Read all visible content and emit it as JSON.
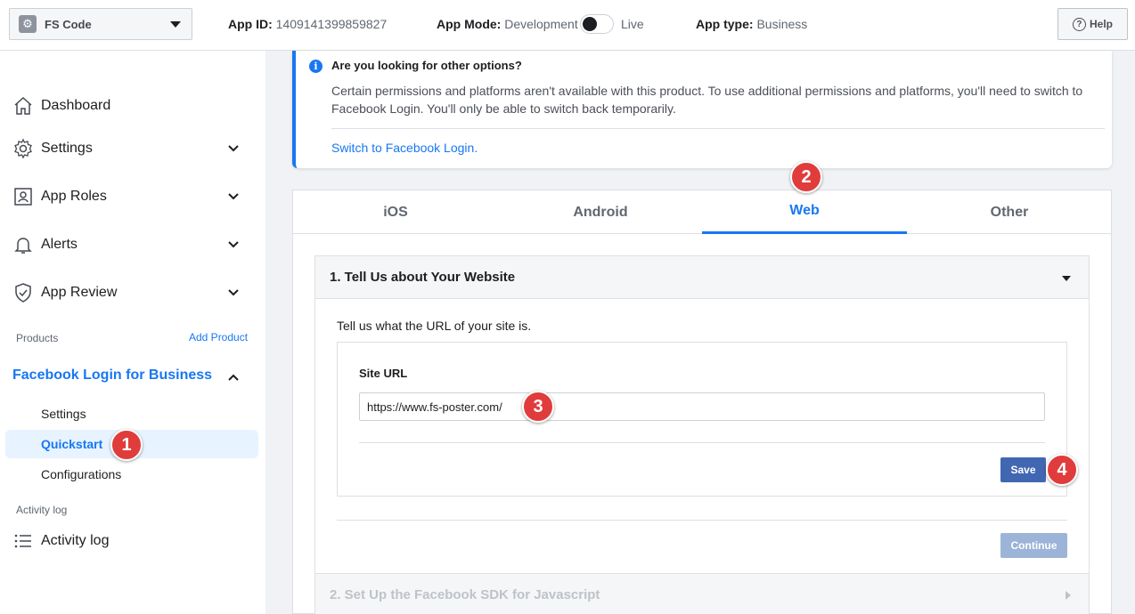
{
  "topbar": {
    "app_name": "FS Code",
    "app_id_label": "App ID:",
    "app_id_value": "1409141399859827",
    "app_mode_label": "App Mode:",
    "app_mode_value": "Development",
    "app_mode_toggle_label": "Live",
    "app_mode_live": false,
    "app_type_label": "App type:",
    "app_type_value": "Business",
    "help_label": "Help"
  },
  "sidebar": {
    "items": [
      {
        "label": "Dashboard",
        "icon": "home-icon"
      },
      {
        "label": "Settings",
        "icon": "gear-icon"
      },
      {
        "label": "App Roles",
        "icon": "person-badge-icon"
      },
      {
        "label": "Alerts",
        "icon": "bell-icon"
      },
      {
        "label": "App Review",
        "icon": "shield-check-icon"
      }
    ],
    "products_label": "Products",
    "add_product_label": "Add Product",
    "product_title": "Facebook Login for Business",
    "product_subitems": [
      "Settings",
      "Quickstart",
      "Configurations"
    ],
    "active_subitem": "Quickstart",
    "activity_section_label": "Activity log",
    "activity_item_label": "Activity log"
  },
  "notice": {
    "title": "Are you looking for other options?",
    "body": "Certain permissions and platforms aren't available with this product. To use additional permissions and platforms, you'll need to switch to Facebook Login. You'll only be able to switch back temporarily.",
    "link": "Switch to Facebook Login."
  },
  "tabs": [
    {
      "label": "iOS"
    },
    {
      "label": "Android"
    },
    {
      "label": "Web"
    },
    {
      "label": "Other"
    }
  ],
  "active_tab": "Web",
  "step1": {
    "title": "1. Tell Us about Your Website",
    "intro": "Tell us what the URL of your site is.",
    "site_url_label": "Site URL",
    "site_url_value": "https://www.fs-poster.com/",
    "save_label": "Save",
    "continue_label": "Continue"
  },
  "step2": {
    "title": "2. Set Up the Facebook SDK for Javascript"
  },
  "badges": [
    "1",
    "2",
    "3",
    "4"
  ],
  "colors": {
    "accent": "#1877f2",
    "badge": "#e03c3c",
    "save_button": "#4267b2",
    "continue_button_disabled": "#9cb4d8"
  }
}
